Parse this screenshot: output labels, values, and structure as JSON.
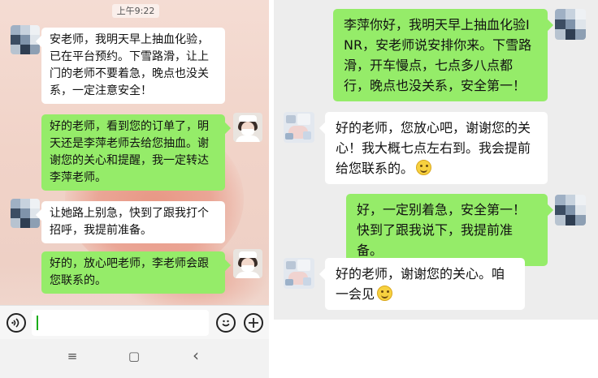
{
  "left_chat": {
    "timestamp": "上午9:22",
    "messages": [
      {
        "side": "in",
        "text": "安老师，我明天早上抽血化验，已在平台预约。下雪路滑，让上门的老师不要着急，晚点也没关系，一定注意安全！"
      },
      {
        "side": "out",
        "text": "好的老师，看到您的订单了，明天还是李萍老师去给您抽血。谢谢您的关心和提醒，我一定转达李萍老师。"
      },
      {
        "side": "in",
        "text": "让她路上别急，快到了跟我打个招呼，我提前准备。"
      },
      {
        "side": "out",
        "text": "好的，放心吧老师，李老师会跟您联系的。"
      }
    ],
    "input": {
      "value": "",
      "placeholder": ""
    },
    "icons": {
      "voice": "voice-icon",
      "emoji": "emoji-icon",
      "plus": "plus-icon"
    },
    "nav": {
      "menu": "≡",
      "home": "▢",
      "back": "‹"
    }
  },
  "right_chat": {
    "messages": [
      {
        "side": "out",
        "text": "李萍你好，我明天早上抽血化验INR，安老师说安排你来。下雪路滑，开车慢点，七点多八点都行，晚点也没关系，安全第一！"
      },
      {
        "side": "in",
        "text": "好的老师，您放心吧，谢谢您的关心！我大概七点左右到。我会提前给您联系的。",
        "emoji": true
      },
      {
        "side": "out",
        "text": "好，一定别着急，安全第一！快到了跟我说下，我提前准备。"
      },
      {
        "side": "in",
        "text": "好的老师，谢谢您的关心。咱一会见",
        "emoji": true
      }
    ]
  },
  "colors": {
    "green_bubble": "#95ec69",
    "white_bubble": "#ffffff",
    "chat_bg_right": "#ededed",
    "chat_bg_left": "#f1d3c8"
  }
}
